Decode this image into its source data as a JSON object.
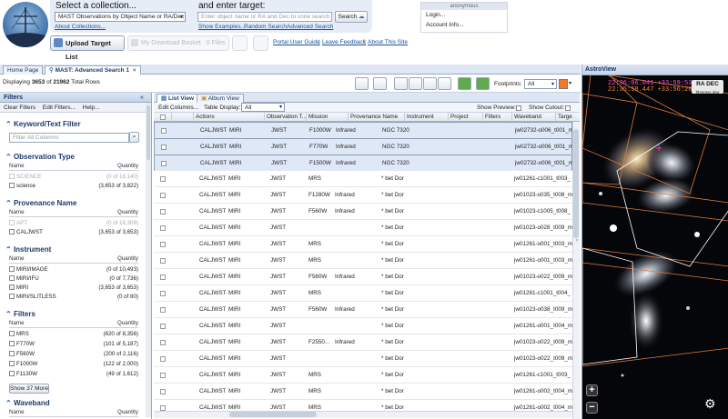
{
  "header": {
    "collection_prompt": "Select a collection...",
    "collection_value": "MAST Observations by Object Name or RA/Dec",
    "about_collections": "About Collections...",
    "target_prompt": "and enter target:",
    "target_placeholder": "Enter object name or RA and Dec to cone search",
    "search_label": "Search",
    "show_examples": "Show Examples...",
    "random_search": "Random Search",
    "advanced_search": "Advanced Search",
    "upload_label": "Upload Target List",
    "download_basket": "My Download Basket",
    "download_count": "0 Files",
    "user_guide": "Portal User Guide",
    "leave_feedback": "Leave Feedback",
    "about_site": "About This Site",
    "sep": "|"
  },
  "account": {
    "title": "anonymous",
    "login": "Login...",
    "account_info": "Account Info..."
  },
  "tabs": {
    "home": "Home Page",
    "search": "MAST: Advanced Search 1"
  },
  "status": {
    "displaying": "Displaying",
    "shown": "3653",
    "of": "of",
    "total": "21962",
    "suffix": "Total Rows"
  },
  "footprints": {
    "label": "Footprints:",
    "value": "All",
    "color": "#f07a2a"
  },
  "filters": {
    "title": "Filters",
    "clear": "Clear Filters",
    "edit": "Edit Filters...",
    "help": "Help...",
    "keyword_title": "Keyword/Text Filter",
    "keyword_placeholder": "Filter All Columns",
    "name_col": "Name",
    "qty_col": "Quantity",
    "observation_type": {
      "title": "Observation Type",
      "rows": [
        {
          "name": "SCIENCE",
          "qty": "(0 of 18,140)",
          "disabled": true
        },
        {
          "name": "science",
          "qty": "(3,653 of 3,822)",
          "disabled": false
        }
      ]
    },
    "provenance": {
      "title": "Provenance Name",
      "rows": [
        {
          "name": "APT",
          "qty": "(0 of 18,309)",
          "disabled": true
        },
        {
          "name": "CALJWST",
          "qty": "(3,653 of 3,653)",
          "disabled": false
        }
      ]
    },
    "instrument": {
      "title": "Instrument",
      "rows": [
        {
          "name": "MIRI/IMAGE",
          "qty": "(0 of 10,493)"
        },
        {
          "name": "MIRI/IFU",
          "qty": "(0 of 7,736)"
        },
        {
          "name": "MIRI",
          "qty": "(3,653 of 3,653)"
        },
        {
          "name": "MIRI/SLITLESS",
          "qty": "(0 of 80)"
        }
      ]
    },
    "filters_facet": {
      "title": "Filters",
      "rows": [
        {
          "name": "MRS",
          "qty": "(620 of 8,356)"
        },
        {
          "name": "F770W",
          "qty": "(101 of 5,187)"
        },
        {
          "name": "F560W",
          "qty": "(200 of 2,116)"
        },
        {
          "name": "F1000W",
          "qty": "(122 of 2,000)"
        },
        {
          "name": "F1130W",
          "qty": "(49 of 1,612)"
        }
      ]
    },
    "show_more": "Show 37 More",
    "waveband_title": "Waveband"
  },
  "grid": {
    "list_view": "List View",
    "album_view": "Album View",
    "edit_columns": "Edit Columns...",
    "table_display": "Table Display:",
    "table_display_value": "All",
    "show_preview": "Show Preview:",
    "show_cutout": "Show Cutout:",
    "columns": [
      "Actions",
      "Observation T...",
      "Mission",
      "Provenance Name",
      "Instrument",
      "Project",
      "Filters",
      "Waveband",
      "Target N"
    ],
    "rows": [
      {
        "c1": "CALJWST",
        "c2": "MIRI",
        "c3": "JWST",
        "c4": "F1000W",
        "c5": "Infrared",
        "c6": "NGC 7320",
        "c7": "jw02732-o006_t001_m",
        "sel": true
      },
      {
        "c1": "CALJWST",
        "c2": "MIRI",
        "c3": "JWST",
        "c4": "F770W",
        "c5": "Infrared",
        "c6": "NGC 7320",
        "c7": "jw02732-o006_t001_m",
        "sel": true
      },
      {
        "c1": "CALJWST",
        "c2": "MIRI",
        "c3": "JWST",
        "c4": "F1500W",
        "c5": "Infrared",
        "c6": "NGC 7320",
        "c7": "jw02732-o006_t001_m",
        "sel": true
      },
      {
        "c1": "CALJWST",
        "c2": "MIRI",
        "c3": "JWST",
        "c4": "MRS",
        "c5": "",
        "c6": "* bet Dor",
        "c7": "jw01261-c1001_t003_",
        "sel": false
      },
      {
        "c1": "CALJWST",
        "c2": "MIRI",
        "c3": "JWST",
        "c4": "F1280W",
        "c5": "Infrared",
        "c6": "* bet Dor",
        "c7": "jw01023-o035_t008_m",
        "sel": false
      },
      {
        "c1": "CALJWST",
        "c2": "MIRI",
        "c3": "JWST",
        "c4": "F560W",
        "c5": "Infrared",
        "c6": "* bet Dor",
        "c7": "jw01023-c1005_t008_",
        "sel": false
      },
      {
        "c1": "CALJWST",
        "c2": "MIRI",
        "c3": "JWST",
        "c4": "",
        "c5": "",
        "c6": "* bet Dor",
        "c7": "jw01023-o028_t009_m",
        "sel": false
      },
      {
        "c1": "CALJWST",
        "c2": "MIRI",
        "c3": "JWST",
        "c4": "MRS",
        "c5": "",
        "c6": "* bet Dor",
        "c7": "jw01261-o001_t003_m",
        "sel": false
      },
      {
        "c1": "CALJWST",
        "c2": "MIRI",
        "c3": "JWST",
        "c4": "MRS",
        "c5": "",
        "c6": "* bet Dor",
        "c7": "jw01261-o001_t003_m",
        "sel": false
      },
      {
        "c1": "CALJWST",
        "c2": "MIRI",
        "c3": "JWST",
        "c4": "F560W",
        "c5": "Infrared",
        "c6": "* bet Dor",
        "c7": "jw01023-o022_t009_m",
        "sel": false
      },
      {
        "c1": "CALJWST",
        "c2": "MIRI",
        "c3": "JWST",
        "c4": "MRS",
        "c5": "",
        "c6": "* bet Dor",
        "c7": "jw01261-c1001_t004_",
        "sel": false
      },
      {
        "c1": "CALJWST",
        "c2": "MIRI",
        "c3": "JWST",
        "c4": "F560W",
        "c5": "Infrared",
        "c6": "* bet Dor",
        "c7": "jw01023-o038_t009_m",
        "sel": false
      },
      {
        "c1": "CALJWST",
        "c2": "MIRI",
        "c3": "JWST",
        "c4": "",
        "c5": "",
        "c6": "* bet Dor",
        "c7": "jw01261-o001_t004_m",
        "sel": false
      },
      {
        "c1": "CALJWST",
        "c2": "MIRI",
        "c3": "JWST",
        "c4": "F2550...",
        "c5": "Infrared",
        "c6": "* bet Dor",
        "c7": "jw01023-o022_t009_m",
        "sel": false
      },
      {
        "c1": "CALJWST",
        "c2": "MIRI",
        "c3": "JWST",
        "c4": "",
        "c5": "",
        "c6": "* bet Dor",
        "c7": "jw01023-o022_t009_m",
        "sel": false
      },
      {
        "c1": "CALJWST",
        "c2": "MIRI",
        "c3": "JWST",
        "c4": "MRS",
        "c5": "",
        "c6": "* bet Dor",
        "c7": "jw01261-c1001_t003_",
        "sel": false
      },
      {
        "c1": "CALJWST",
        "c2": "MIRI",
        "c3": "JWST",
        "c4": "MRS",
        "c5": "",
        "c6": "* bet Dor",
        "c7": "jw01261-o002_t004_m",
        "sel": false
      },
      {
        "c1": "CALJWST",
        "c2": "MIRI",
        "c3": "JWST",
        "c4": "MRS",
        "c5": "",
        "c6": "* bet Dor",
        "c7": "jw01261-o002_t004_m",
        "sel": false
      }
    ]
  },
  "astroview": {
    "title": "AstroView",
    "coord1": "22:36:06.041 +33:59:53.67",
    "coord2": "22:35:58.447 +33:56:28.69",
    "mode": "RA DEC",
    "mode_sub": "hhmmss deg",
    "zoom_in": "+",
    "zoom_out": "−",
    "footprint_color": "#e07a3c",
    "selected_color": "#ffffff"
  }
}
